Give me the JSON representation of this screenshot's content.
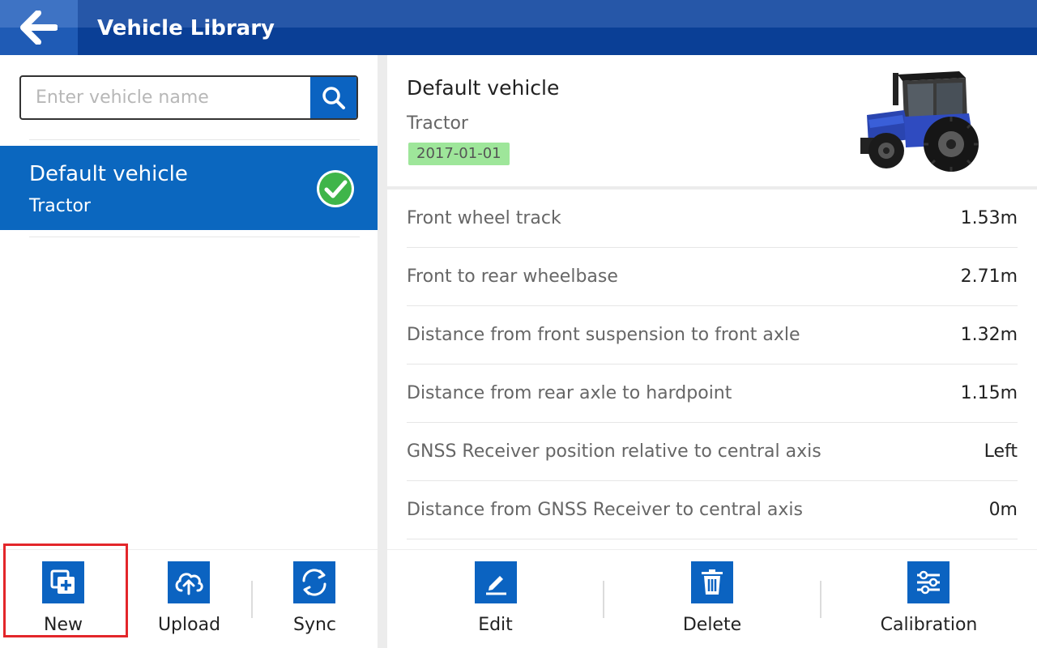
{
  "header": {
    "title": "Vehicle Library"
  },
  "search": {
    "placeholder": "Enter vehicle name"
  },
  "vehicle_list": [
    {
      "name": "Default vehicle",
      "type": "Tractor",
      "selected": true
    }
  ],
  "detail": {
    "name": "Default vehicle",
    "type": "Tractor",
    "date": "2017-01-01",
    "properties": [
      {
        "label": "Front wheel track",
        "value": "1.53m"
      },
      {
        "label": "Front to rear wheelbase",
        "value": "2.71m"
      },
      {
        "label": "Distance from front suspension to front axle",
        "value": "1.32m"
      },
      {
        "label": "Distance from rear axle to hardpoint",
        "value": "1.15m"
      },
      {
        "label": "GNSS Receiver position relative to central axis",
        "value": "Left"
      },
      {
        "label": "Distance from GNSS Receiver to central axis",
        "value": "0m"
      }
    ]
  },
  "toolbar_left": [
    {
      "label": "New",
      "icon": "new-copy-icon"
    },
    {
      "label": "Upload",
      "icon": "cloud-upload-icon"
    },
    {
      "label": "Sync",
      "icon": "sync-icon"
    }
  ],
  "toolbar_right": [
    {
      "label": "Edit",
      "icon": "edit-pencil-icon"
    },
    {
      "label": "Delete",
      "icon": "trash-icon"
    },
    {
      "label": "Calibration",
      "icon": "sliders-icon"
    }
  ],
  "colors": {
    "header": "#0a3f96",
    "accent": "#0b63c1",
    "selected_item": "#0b67bf",
    "date_badge": "#9ee69a",
    "highlight": "#e3262a"
  }
}
